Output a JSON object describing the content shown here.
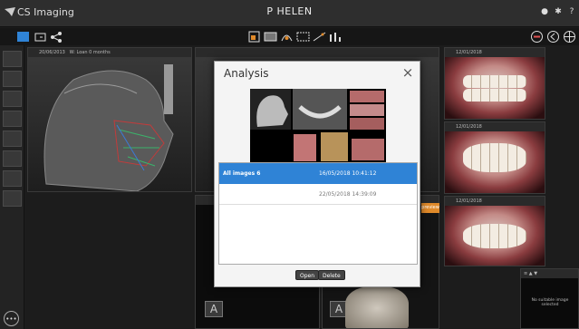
{
  "app": {
    "name": "CS Imaging",
    "patient": "P HELEN"
  },
  "titlebar_icons": [
    "info-icon",
    "settings-icon",
    "help-icon"
  ],
  "toolbar": {
    "left_icons": [
      "layout-icon",
      "capture-icon",
      "share-icon"
    ],
    "center_icons": [
      "image-tool-icon",
      "film-icon",
      "ceph-tool-icon",
      "pano-tool-icon",
      "measure-tool-icon",
      "analysis-tool-icon"
    ],
    "right_icons": [
      "menu-icon",
      "back-icon",
      "globe-icon"
    ]
  },
  "panels": {
    "ceph": {
      "date": "20/06/2013",
      "caption": "W: Loan 0 months"
    },
    "p1": {
      "date": "12/01/2018"
    },
    "p2": {
      "date": "12/01/2018"
    },
    "p3": {
      "date": "12/01/2018"
    },
    "bottom_right": {
      "message": "No suitable image selected"
    },
    "a_label": "A"
  },
  "badge": {
    "label": "preview"
  },
  "modal": {
    "title": "Analysis",
    "close": "×",
    "rows": [
      {
        "name": "All images 6",
        "date": "16/05/2018 10:41:12"
      },
      {
        "name": "",
        "date": "22/05/2018 14:39:09"
      }
    ],
    "buttons": {
      "open": "Open",
      "delete": "Delete"
    }
  },
  "colors": {
    "selection": "#2f83d6",
    "accent": "#e08a2a"
  }
}
